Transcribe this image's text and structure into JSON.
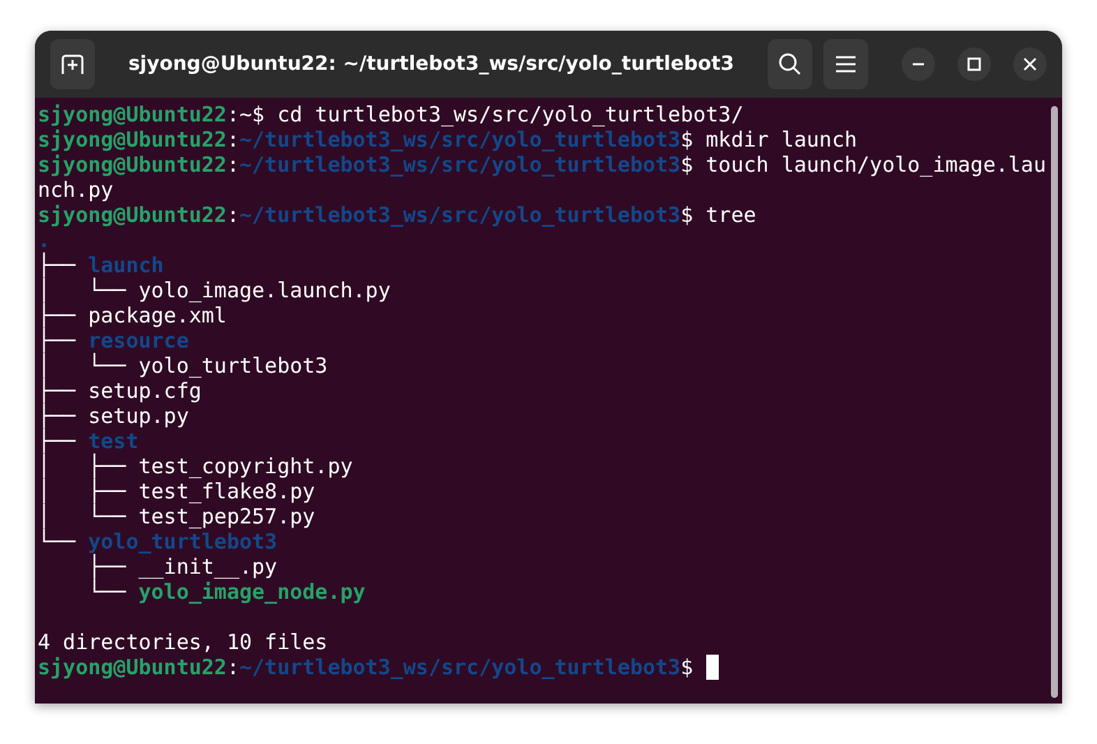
{
  "window": {
    "title": "sjyong@Ubuntu22: ~/turtlebot3_ws/src/yolo_turtlebot3"
  },
  "terminal": {
    "lines": [
      {
        "kind": "text",
        "segments": [
          {
            "text": "sjyong@Ubuntu22",
            "kind": "user"
          },
          {
            "text": ":~$ cd turtlebot3_ws/src/yolo_turtlebot3/",
            "kind": "plain"
          }
        ]
      },
      {
        "kind": "text",
        "segments": [
          {
            "text": "sjyong@Ubuntu22",
            "kind": "user"
          },
          {
            "text": ":",
            "kind": "plain"
          },
          {
            "text": "~/turtlebot3_ws/src/yolo_turtlebot3",
            "kind": "path"
          },
          {
            "text": "$ mkdir launch",
            "kind": "plain"
          }
        ]
      },
      {
        "kind": "text",
        "segments": [
          {
            "text": "sjyong@Ubuntu22",
            "kind": "user"
          },
          {
            "text": ":",
            "kind": "plain"
          },
          {
            "text": "~/turtlebot3_ws/src/yolo_turtlebot3",
            "kind": "path"
          },
          {
            "text": "$ touch launch/yolo_image.lau",
            "kind": "plain"
          }
        ]
      },
      {
        "kind": "text",
        "segments": [
          {
            "text": "nch.py",
            "kind": "plain"
          }
        ]
      },
      {
        "kind": "text",
        "segments": [
          {
            "text": "sjyong@Ubuntu22",
            "kind": "user"
          },
          {
            "text": ":",
            "kind": "plain"
          },
          {
            "text": "~/turtlebot3_ws/src/yolo_turtlebot3",
            "kind": "path"
          },
          {
            "text": "$ tree",
            "kind": "plain"
          }
        ]
      },
      {
        "kind": "text",
        "segments": [
          {
            "text": ".",
            "kind": "dir"
          }
        ]
      },
      {
        "kind": "text",
        "segments": [
          {
            "text": "├── ",
            "kind": "plain"
          },
          {
            "text": "launch",
            "kind": "dir"
          }
        ]
      },
      {
        "kind": "text",
        "segments": [
          {
            "text": "│   └── yolo_image.launch.py",
            "kind": "plain"
          }
        ]
      },
      {
        "kind": "text",
        "segments": [
          {
            "text": "├── package.xml",
            "kind": "plain"
          }
        ]
      },
      {
        "kind": "text",
        "segments": [
          {
            "text": "├── ",
            "kind": "plain"
          },
          {
            "text": "resource",
            "kind": "dir"
          }
        ]
      },
      {
        "kind": "text",
        "segments": [
          {
            "text": "│   └── yolo_turtlebot3",
            "kind": "plain"
          }
        ]
      },
      {
        "kind": "text",
        "segments": [
          {
            "text": "├── setup.cfg",
            "kind": "plain"
          }
        ]
      },
      {
        "kind": "text",
        "segments": [
          {
            "text": "├── setup.py",
            "kind": "plain"
          }
        ]
      },
      {
        "kind": "text",
        "segments": [
          {
            "text": "├── ",
            "kind": "plain"
          },
          {
            "text": "test",
            "kind": "dir"
          }
        ]
      },
      {
        "kind": "text",
        "segments": [
          {
            "text": "│   ├── test_copyright.py",
            "kind": "plain"
          }
        ]
      },
      {
        "kind": "text",
        "segments": [
          {
            "text": "│   ├── test_flake8.py",
            "kind": "plain"
          }
        ]
      },
      {
        "kind": "text",
        "segments": [
          {
            "text": "│   └── test_pep257.py",
            "kind": "plain"
          }
        ]
      },
      {
        "kind": "text",
        "segments": [
          {
            "text": "└── ",
            "kind": "plain"
          },
          {
            "text": "yolo_turtlebot3",
            "kind": "dir"
          }
        ]
      },
      {
        "kind": "text",
        "segments": [
          {
            "text": "    ├── __init__.py",
            "kind": "plain"
          }
        ]
      },
      {
        "kind": "text",
        "segments": [
          {
            "text": "    └── ",
            "kind": "plain"
          },
          {
            "text": "yolo_image_node.py",
            "kind": "exec"
          }
        ]
      },
      {
        "kind": "blank"
      },
      {
        "kind": "text",
        "segments": [
          {
            "text": "4 directories, 10 files",
            "kind": "plain"
          }
        ]
      },
      {
        "kind": "prompt_cursor",
        "segments": [
          {
            "text": "sjyong@Ubuntu22",
            "kind": "user"
          },
          {
            "text": ":",
            "kind": "plain"
          },
          {
            "text": "~/turtlebot3_ws/src/yolo_turtlebot3",
            "kind": "path"
          },
          {
            "text": "$ ",
            "kind": "plain"
          }
        ]
      }
    ]
  }
}
